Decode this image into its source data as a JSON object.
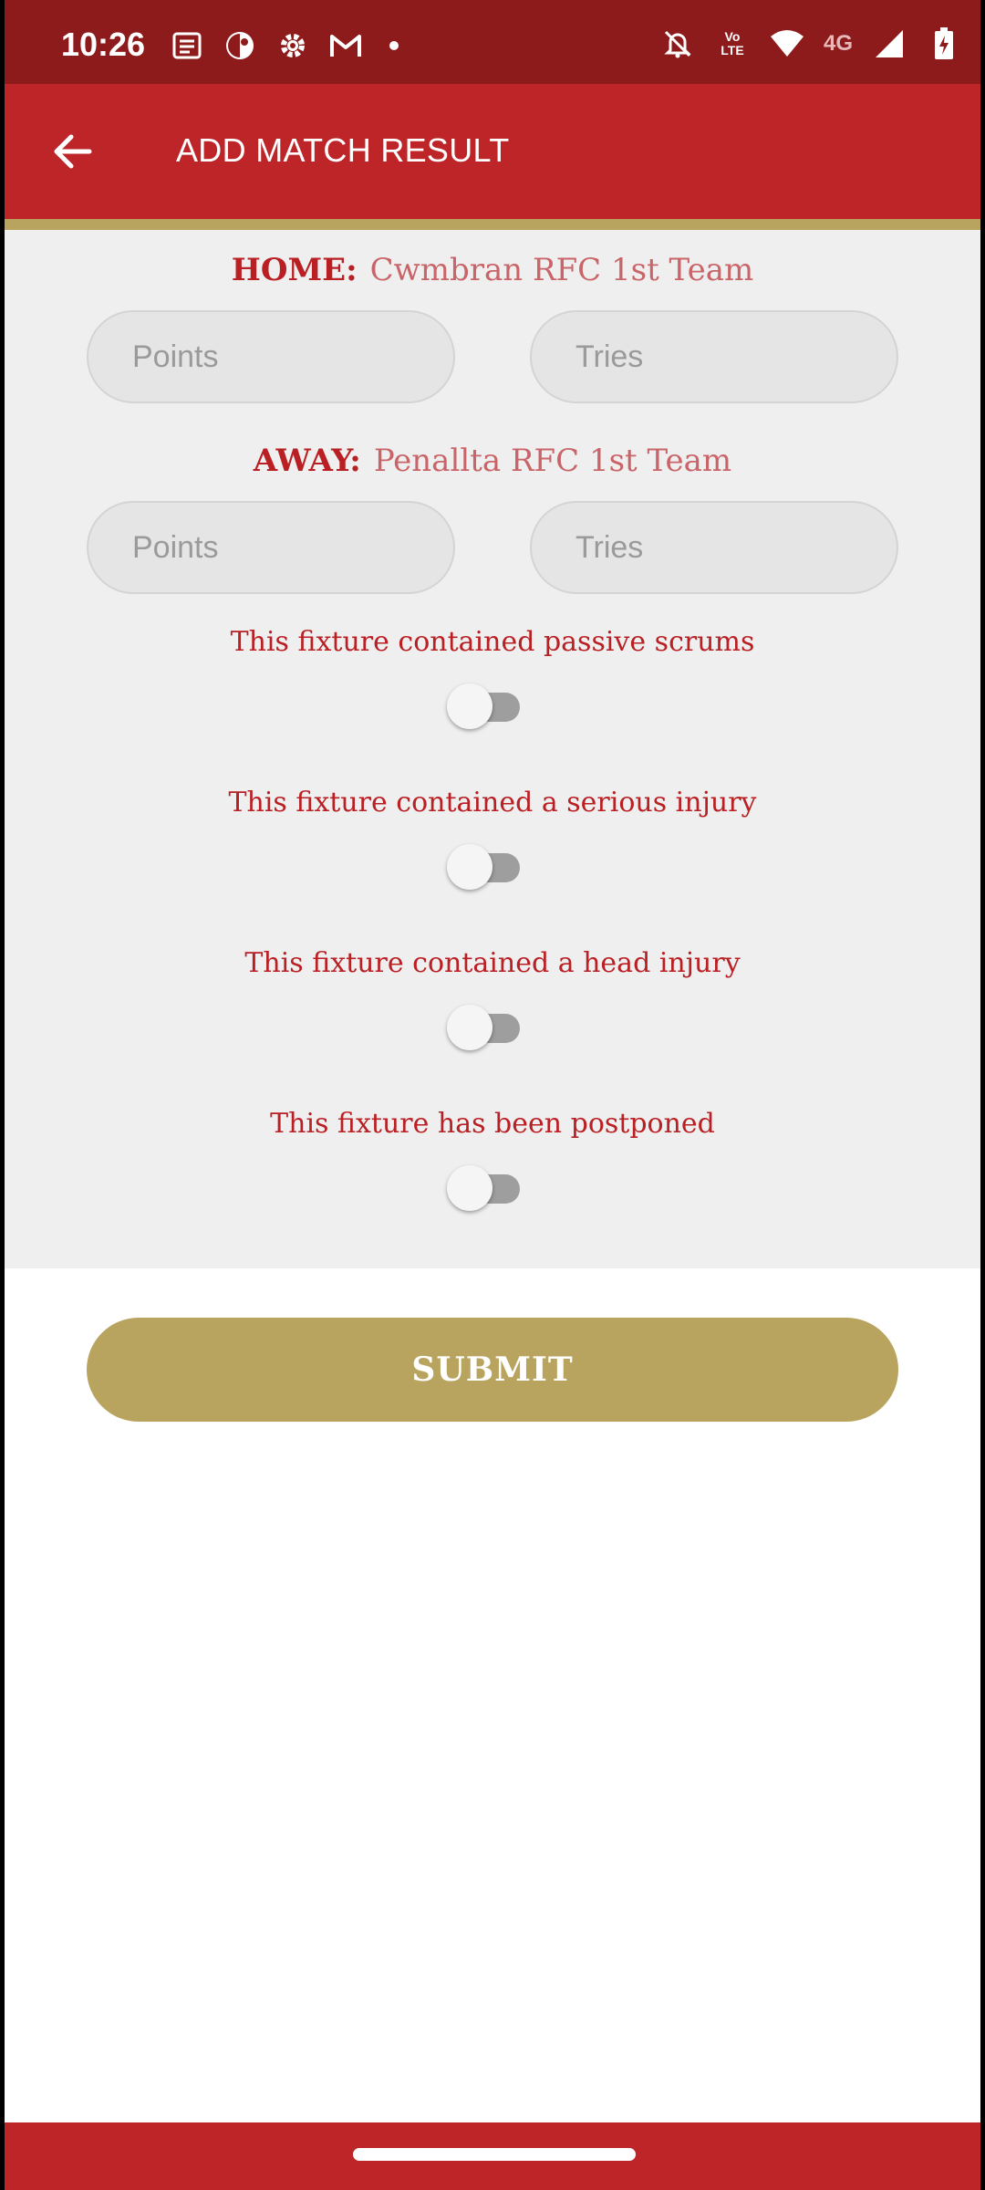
{
  "status_bar": {
    "time": "10:26",
    "left_icons": [
      "news-icon",
      "circle-app-icon",
      "gear-icon",
      "gmail-icon",
      "dot-icon"
    ],
    "right_icons": [
      "mute-icon",
      "volte-icon",
      "wifi-icon",
      "4g-icon",
      "signal-icon",
      "battery-icon"
    ],
    "volte_text": "Vo LTE",
    "network_text": "4G"
  },
  "app_bar": {
    "title": "ADD MATCH RESULT",
    "back_icon": "arrow-left-icon"
  },
  "home": {
    "label": "HOME:",
    "team": "Cwmbran RFC 1st Team",
    "points_placeholder": "Points",
    "tries_placeholder": "Tries"
  },
  "away": {
    "label": "AWAY:",
    "team": "Penallta RFC 1st Team",
    "points_placeholder": "Points",
    "tries_placeholder": "Tries"
  },
  "toggles": [
    {
      "label": "This fixture contained passive scrums",
      "on": false
    },
    {
      "label": "This fixture contained a serious injury",
      "on": false
    },
    {
      "label": "This fixture contained a head injury",
      "on": false
    },
    {
      "label": "This fixture has been postponed",
      "on": false
    }
  ],
  "submit_label": "SUBMIT",
  "colors": {
    "primary_red": "#bd2528",
    "status_red": "#8e1b1b",
    "gold": "#b9a45f",
    "label_red": "#b91f23",
    "form_bg": "#efefef"
  }
}
